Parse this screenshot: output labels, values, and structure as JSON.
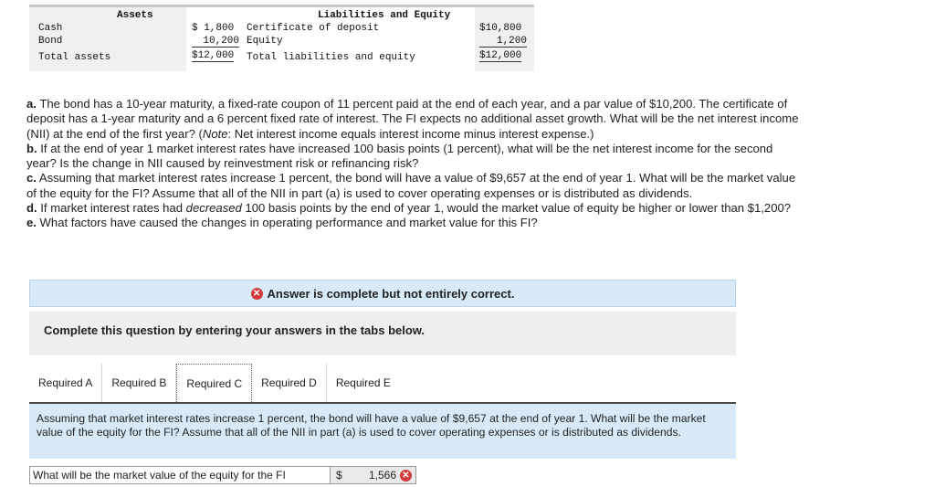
{
  "balance_sheet": {
    "assets_header": "Assets",
    "liab_header": "Liabilities and Equity",
    "rows": [
      {
        "asset": "Cash",
        "asset_amt": "$ 1,800",
        "liab": "Certificate of deposit",
        "liab_amt": "$10,800"
      },
      {
        "asset": "Bond",
        "asset_amt": "10,200",
        "liab": "Equity",
        "liab_amt": "1,200"
      },
      {
        "asset": "Total assets",
        "asset_amt": "$12,000",
        "liab": "Total liabilities and equity",
        "liab_amt": "$12,000"
      }
    ]
  },
  "question": {
    "a_label": "a.",
    "a_text_1": " The bond has a 10-year maturity, a fixed-rate coupon of 11 percent paid at the end of each year, and a par value of $10,200. The certificate of deposit has a 1-year maturity and a 6 percent fixed rate of interest. The FI expects no additional asset growth. What will be the net interest income (NII) at the end of the first year? (",
    "a_note": "Note",
    "a_text_2": ": Net interest income equals interest income minus interest expense.)",
    "b_label": "b.",
    "b_text": " If at the end of year 1 market interest rates have increased 100 basis points (1 percent), what will be the net interest income for the second year? Is the change in NII caused by reinvestment risk or refinancing risk?",
    "c_label": "c.",
    "c_text": " Assuming that market interest rates increase 1 percent, the bond will have a value of $9,657 at the end of year 1. What will be the market value of the equity for the FI? Assume that all of the NII in part (a) is used to cover operating expenses or is distributed as dividends.",
    "d_label": "d.",
    "d_text_1": " If market interest rates had ",
    "d_em": "decreased",
    "d_text_2": " 100 basis points by the end of year 1, would the market value of equity be higher or lower than $1,200?",
    "e_label": "e.",
    "e_text": " What factors have caused the changes in operating performance and market value for this FI?"
  },
  "banner": {
    "text": "Answer is complete but not entirely correct.",
    "icon": "x-circle-icon",
    "color": "#d23b3b"
  },
  "instructions": "Complete this question by entering your answers in the tabs below.",
  "tabs": [
    {
      "label": "Required A"
    },
    {
      "label": "Required B"
    },
    {
      "label": "Required C",
      "active": true
    },
    {
      "label": "Required D"
    },
    {
      "label": "Required E"
    }
  ],
  "tab_panel_text": "Assuming that market interest rates increase 1 percent, the bond will have a value of $9,657 at the end of year 1. What will be the market value of the equity for the FI? Assume that all of the NII in part (a) is used to cover operating expenses or is distributed as dividends.",
  "answer_row": {
    "question": "What will be the market value of the equity for the FI",
    "currency": "$",
    "value": "1,566",
    "status": "incorrect"
  }
}
